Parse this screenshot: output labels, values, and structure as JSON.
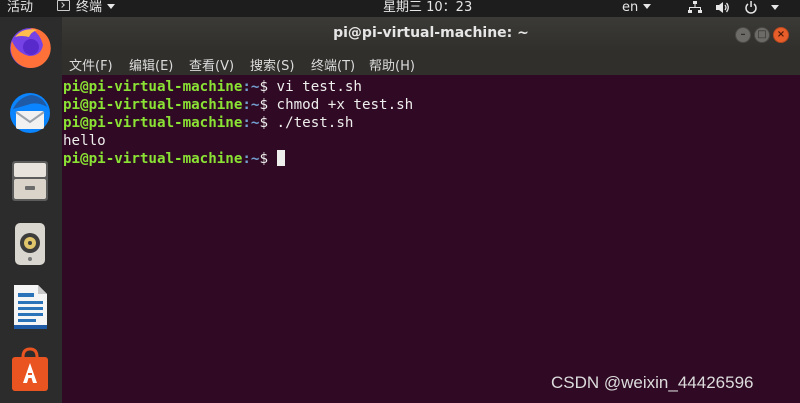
{
  "topbar": {
    "activities": "活动",
    "app_menu": "终端",
    "clock": "星期三 10：23",
    "language": "en"
  },
  "dock": {
    "items": [
      "firefox-icon",
      "thunderbird-icon",
      "files-icon",
      "rhythmbox-icon",
      "libreoffice-writer-icon",
      "software-center-icon"
    ]
  },
  "window": {
    "title": "pi@pi-virtual-machine: ~",
    "menu": [
      "文件(F)",
      "编辑(E)",
      "查看(V)",
      "搜索(S)",
      "终端(T)",
      "帮助(H)"
    ]
  },
  "terminal": {
    "lines": [
      {
        "user": "pi@pi-virtual-machine",
        "path": ":~",
        "cmd": "$ vi test.sh"
      },
      {
        "user": "pi@pi-virtual-machine",
        "path": ":~",
        "cmd": "$ chmod +x test.sh"
      },
      {
        "user": "pi@pi-virtual-machine",
        "path": ":~",
        "cmd": "$ ./test.sh"
      },
      {
        "output": "hello"
      },
      {
        "user": "pi@pi-virtual-machine",
        "path": ":~",
        "cmd": "$ "
      }
    ]
  },
  "watermark": "CSDN @weixin_44426596",
  "colors": {
    "terminal_bg": "#300a24",
    "prompt_user": "#8ae234",
    "prompt_path": "#729fcf",
    "close_button": "#e85e2a"
  }
}
